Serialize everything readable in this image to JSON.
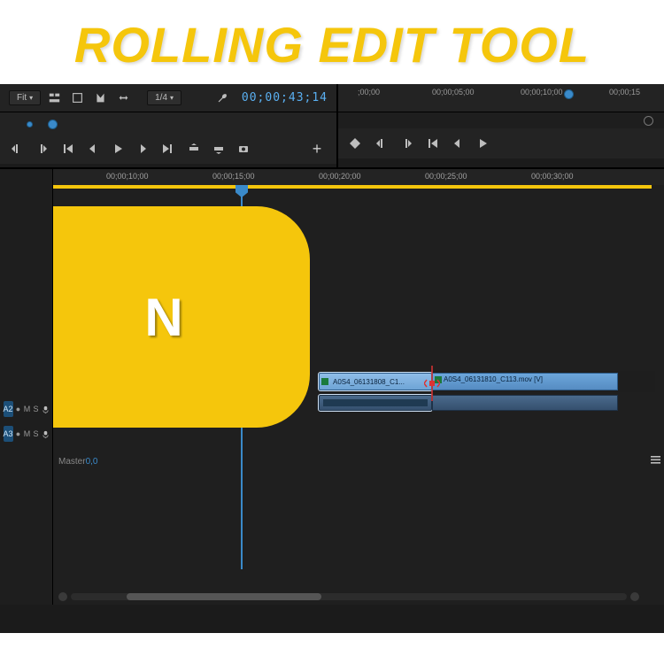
{
  "title": "ROLLING EDIT TOOL",
  "shortcut_key": "N",
  "colors": {
    "accent": "#f5c60c",
    "playhead": "#3a8aca",
    "bg": "#1b1b1b"
  },
  "toolbar": {
    "fit_label": "Fit",
    "scale_label": "1/4",
    "timecode": "00;00;43;14",
    "icons": {
      "dual": "timeline-dual-icon",
      "overlay": "overlay-icon",
      "adjust": "adjust-icon",
      "marker": "marker-icon",
      "arrow": "arrows-icon",
      "wrench": "wrench-icon"
    }
  },
  "upper_ruler": {
    "labels": [
      ";00;00",
      "00;00;05;00",
      "00;00;10;00",
      "00;00;15"
    ]
  },
  "transport_left": {
    "icons": [
      "marker-in-icon",
      "marker-out-icon",
      "jump-start-icon",
      "step-back-icon",
      "play-icon",
      "step-fwd-icon",
      "jump-end-icon",
      "trim1-icon",
      "trim2-icon",
      "camera-icon"
    ]
  },
  "timeline_ruler": {
    "labels": [
      "00;00;10;00",
      "00;00;15;00",
      "00;00;20;00",
      "00;00;25;00",
      "00;00;30;00"
    ],
    "playhead_pct": 31
  },
  "tracks": {
    "audio": [
      {
        "chip": "A2",
        "m": "M",
        "s": "S"
      },
      {
        "chip": "A3",
        "m": "M",
        "s": "S"
      }
    ],
    "master_label": "Master",
    "master_val": "0,0"
  },
  "clips": {
    "clip1_label": "A0S4_06131808_C1...",
    "clip2_label": "A0S4_06131810_C113.mov [V]"
  }
}
